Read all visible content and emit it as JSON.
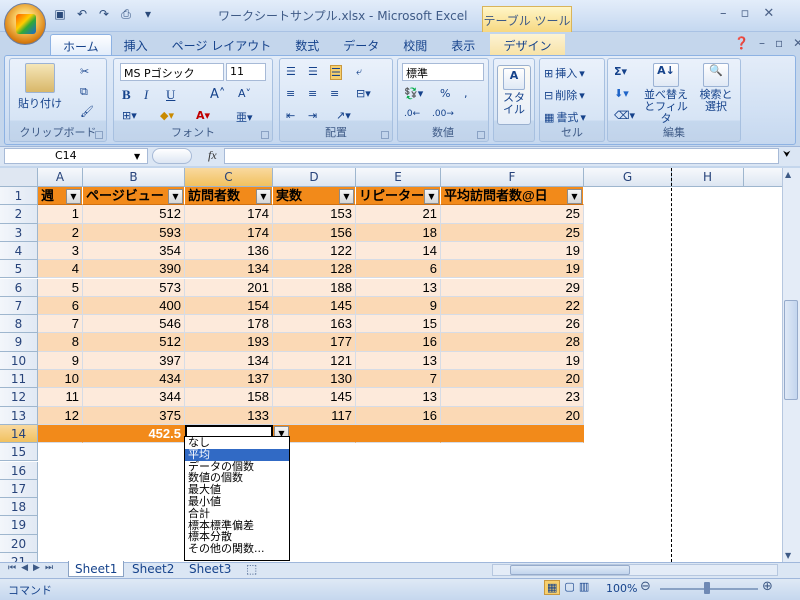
{
  "window": {
    "title": "ワークシートサンプル.xlsx - Microsoft Excel",
    "contextual_tab": "テーブル ツール"
  },
  "ribbon": {
    "tabs": [
      "ホーム",
      "挿入",
      "ページ レイアウト",
      "数式",
      "データ",
      "校閲",
      "表示"
    ],
    "design_tab": "デザイン",
    "clipboard": {
      "label": "クリップボード",
      "paste": "貼り付け"
    },
    "font": {
      "label": "フォント",
      "name": "MS Pゴシック",
      "size": "11"
    },
    "alignment": {
      "label": "配置"
    },
    "number": {
      "label": "数値",
      "format": "標準"
    },
    "styles": {
      "label": "スタイル"
    },
    "cells": {
      "label": "セル",
      "insert": "挿入",
      "delete": "削除",
      "format": "書式"
    },
    "editing": {
      "label": "編集",
      "sort": "並べ替え とフィルタ",
      "find": "検索と 選択"
    }
  },
  "formula_bar": {
    "name_box": "C14",
    "fx": "fx",
    "value": ""
  },
  "columns": [
    "A",
    "B",
    "C",
    "D",
    "E",
    "F",
    "G",
    "H"
  ],
  "table": {
    "headers": [
      "週",
      "ページビュー",
      "訪問者数",
      "実数",
      "リピーター",
      "平均訪問者数@日"
    ],
    "rows": [
      [
        1,
        512,
        174,
        153,
        21,
        25
      ],
      [
        2,
        593,
        174,
        156,
        18,
        25
      ],
      [
        3,
        354,
        136,
        122,
        14,
        19
      ],
      [
        4,
        390,
        134,
        128,
        6,
        19
      ],
      [
        5,
        573,
        201,
        188,
        13,
        29
      ],
      [
        6,
        400,
        154,
        145,
        9,
        22
      ],
      [
        7,
        546,
        178,
        163,
        15,
        26
      ],
      [
        8,
        512,
        193,
        177,
        16,
        28
      ],
      [
        9,
        397,
        134,
        121,
        13,
        19
      ],
      [
        10,
        434,
        137,
        130,
        7,
        20
      ],
      [
        11,
        344,
        158,
        145,
        13,
        23
      ],
      [
        12,
        375,
        133,
        117,
        16,
        20
      ]
    ],
    "total_row": [
      "",
      "452.5",
      "",
      "",
      "",
      ""
    ]
  },
  "row_numbers": [
    "1",
    "2",
    "3",
    "4",
    "5",
    "6",
    "7",
    "8",
    "9",
    "10",
    "11",
    "12",
    "13",
    "14",
    "15",
    "16",
    "17",
    "18",
    "19",
    "20",
    "21"
  ],
  "dropdown": {
    "items": [
      "なし",
      "平均",
      "データの個数",
      "数値の個数",
      "最大値",
      "最小値",
      "合計",
      "標本標準偏差",
      "標本分散",
      "その他の関数..."
    ],
    "selected": "平均"
  },
  "sheets": [
    "Sheet1",
    "Sheet2",
    "Sheet3"
  ],
  "active_sheet": "Sheet1",
  "status": {
    "mode": "コマンド",
    "zoom": "100%"
  }
}
